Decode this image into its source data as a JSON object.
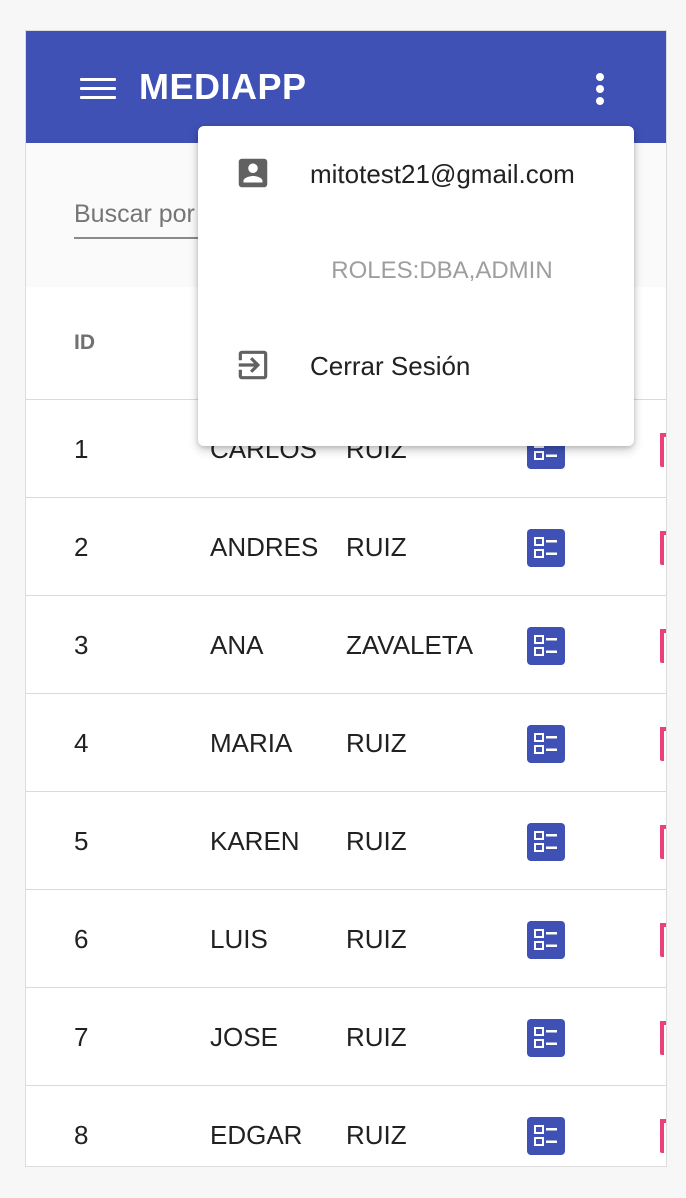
{
  "toolbar": {
    "title": "MEDIAPP",
    "color": "#3f51b5"
  },
  "search": {
    "placeholder": "Buscar por nombres"
  },
  "table": {
    "headers": {
      "id": "ID"
    },
    "rows": [
      {
        "id": "1",
        "nombre": "CARLOS",
        "apellido": "RUIZ"
      },
      {
        "id": "2",
        "nombre": "ANDRES",
        "apellido": "RUIZ"
      },
      {
        "id": "3",
        "nombre": "ANA",
        "apellido": "ZAVALETA"
      },
      {
        "id": "4",
        "nombre": "MARIA",
        "apellido": "RUIZ"
      },
      {
        "id": "5",
        "nombre": "KAREN",
        "apellido": "RUIZ"
      },
      {
        "id": "6",
        "nombre": "LUIS",
        "apellido": "RUIZ"
      },
      {
        "id": "7",
        "nombre": "JOSE",
        "apellido": "RUIZ"
      },
      {
        "id": "8",
        "nombre": "EDGAR",
        "apellido": "RUIZ"
      }
    ],
    "edit_icon": "list-alt-icon",
    "delete_icon": "delete-icon",
    "edit_color": "#3f51b5",
    "delete_color": "#ec407a"
  },
  "user_menu": {
    "email": "mitotest21@gmail.com",
    "roles": "ROLES:DBA,ADMIN",
    "logout_label": "Cerrar Sesión",
    "account_icon": "account-box-icon",
    "logout_icon": "exit-to-app-icon"
  }
}
